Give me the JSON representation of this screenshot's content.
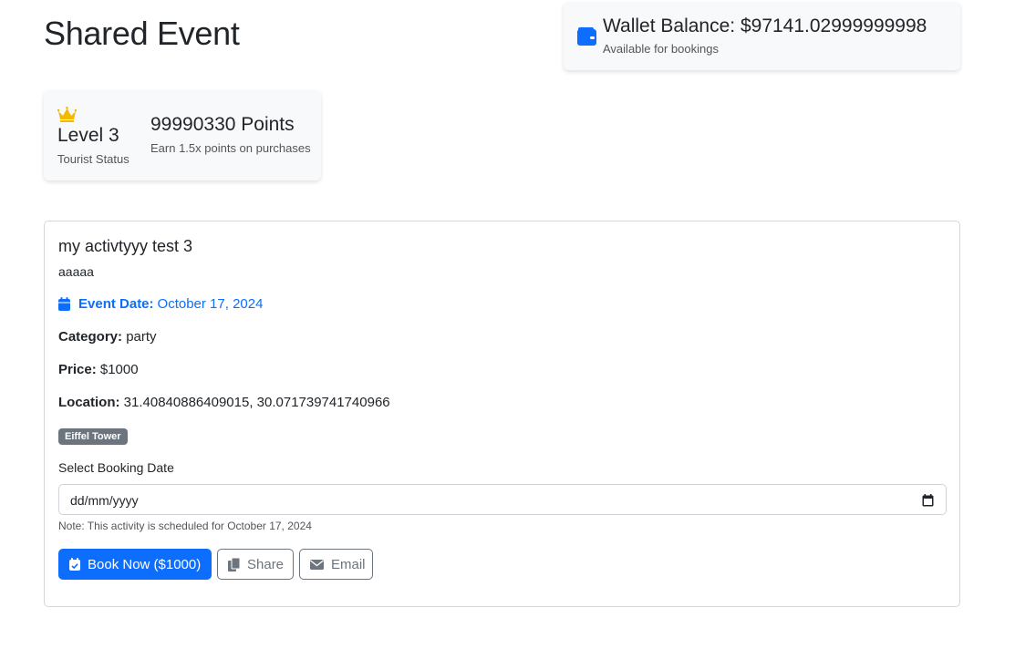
{
  "page": {
    "title": "Shared Event"
  },
  "wallet": {
    "title": "Wallet Balance: $97141.02999999998",
    "subtitle": "Available for bookings",
    "icon": "wallet-icon",
    "color": "#0d6efd"
  },
  "loyalty": {
    "icon": "crown-icon",
    "icon_color": "#f5b800",
    "level": "Level 3",
    "status": "Tourist Status",
    "points": "99990330 Points",
    "points_note": "Earn 1.5x points on purchases"
  },
  "event": {
    "name": "my activtyyy test 3",
    "description": "aaaaa",
    "date_label": "Event Date:",
    "date_value": "October 17, 2024",
    "category_label": "Category:",
    "category_value": "party",
    "price_label": "Price:",
    "price_value": "$1000",
    "location_label": "Location:",
    "location_value": "31.40840886409015, 30.071739741740966",
    "tag": "Eiffel Tower"
  },
  "booking": {
    "label": "Select Booking Date",
    "placeholder": "dd/mm/yyyy",
    "note": "Note: This activity is scheduled for October 17, 2024"
  },
  "actions": {
    "book_label": "Book Now ($1000)",
    "share_label": "Share",
    "email_label": "Email"
  },
  "colors": {
    "primary": "#0d6efd",
    "secondary": "#6c757d",
    "badge": "#6c757d"
  }
}
